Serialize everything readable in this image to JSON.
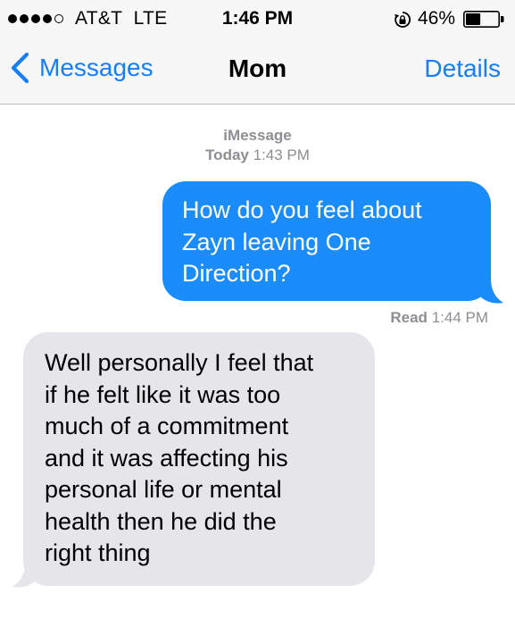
{
  "status_bar": {
    "carrier": "AT&T",
    "network": "LTE",
    "time": "1:46 PM",
    "battery_percent": "46%",
    "signal_bars": 4,
    "signal_max": 5,
    "battery_level": 0.46,
    "icons": [
      "signal-dots-icon",
      "rotation-lock-icon",
      "battery-icon"
    ]
  },
  "nav": {
    "back_label": "Messages",
    "title": "Mom",
    "details_label": "Details",
    "accent": "#157efb"
  },
  "thread": {
    "service": "iMessage",
    "day": "Today",
    "time": "1:43 PM",
    "messages": [
      {
        "direction": "outgoing",
        "lines": [
          "How do you feel about",
          "Zayn leaving One",
          "Direction?"
        ],
        "color": "#1a8cfb"
      },
      {
        "direction": "incoming",
        "lines": [
          "Well personally I feel that",
          "if he felt like it was too",
          "much of a commitment",
          "and it was affecting his",
          "personal life or mental",
          "health then he did the",
          "right thing"
        ],
        "color": "#e5e5ea"
      }
    ],
    "receipt": {
      "status": "Read",
      "time": "1:44 PM"
    }
  }
}
